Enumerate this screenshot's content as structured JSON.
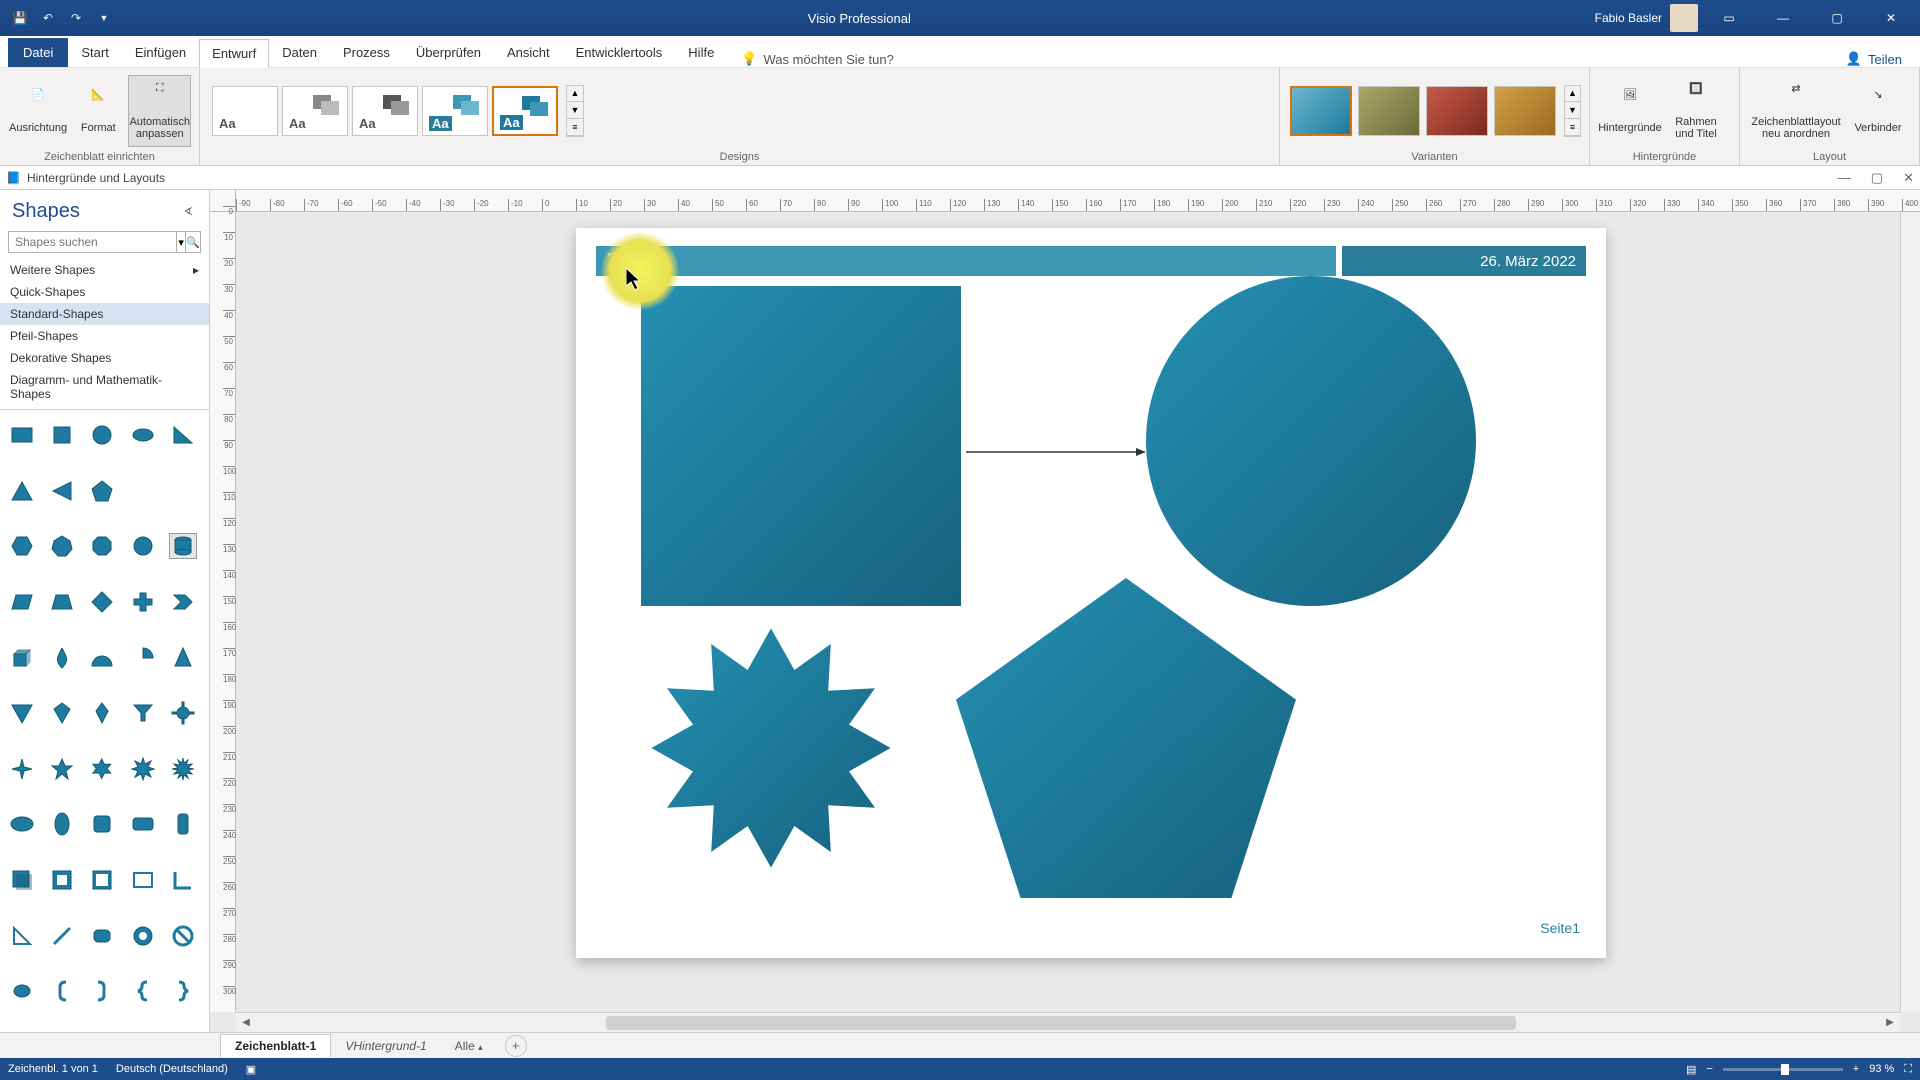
{
  "app": {
    "title": "Visio Professional",
    "user": "Fabio Basler",
    "share": "Teilen"
  },
  "tabs": [
    "Datei",
    "Start",
    "Einfügen",
    "Entwurf",
    "Daten",
    "Prozess",
    "Überprüfen",
    "Ansicht",
    "Entwicklertools",
    "Hilfe"
  ],
  "active_tab": "Entwurf",
  "tell_me": "Was möchten Sie tun?",
  "ribbon_groups": {
    "setup": {
      "label": "Zeichenblatt einrichten",
      "buttons": [
        "Ausrichtung",
        "Format",
        "Automatisch anpassen"
      ]
    },
    "designs": {
      "label": "Designs"
    },
    "variants": {
      "label": "Varianten"
    },
    "backgrounds": {
      "label": "Hintergründe",
      "buttons": [
        "Hintergründe",
        "Rahmen und Titel"
      ]
    },
    "layout": {
      "label": "Layout",
      "buttons": [
        "Zeichenblattlayout neu anordnen",
        "Verbinder"
      ]
    }
  },
  "subwindow_title": "Hintergründe und Layouts",
  "shapes_panel": {
    "title": "Shapes",
    "search_placeholder": "Shapes suchen",
    "more": "Weitere Shapes",
    "stencils": [
      "Quick-Shapes",
      "Standard-Shapes",
      "Pfeil-Shapes",
      "Dekorative Shapes",
      "Diagramm- und Mathematik-Shapes"
    ],
    "active_stencil": "Standard-Shapes"
  },
  "canvas": {
    "title_block": "Titel",
    "date": "26. März 2022",
    "page_label": "Seite1"
  },
  "page_tabs": {
    "tabs": [
      "Zeichenblatt-1",
      "VHintergrund-1",
      "Alle"
    ],
    "active": "Zeichenblatt-1"
  },
  "status": {
    "left1": "Zeichenbl. 1 von 1",
    "left2": "Deutsch (Deutschland)",
    "zoom": "93 %"
  },
  "colors": {
    "teal": "#1d7a9c",
    "teal_dark": "#145d78"
  }
}
